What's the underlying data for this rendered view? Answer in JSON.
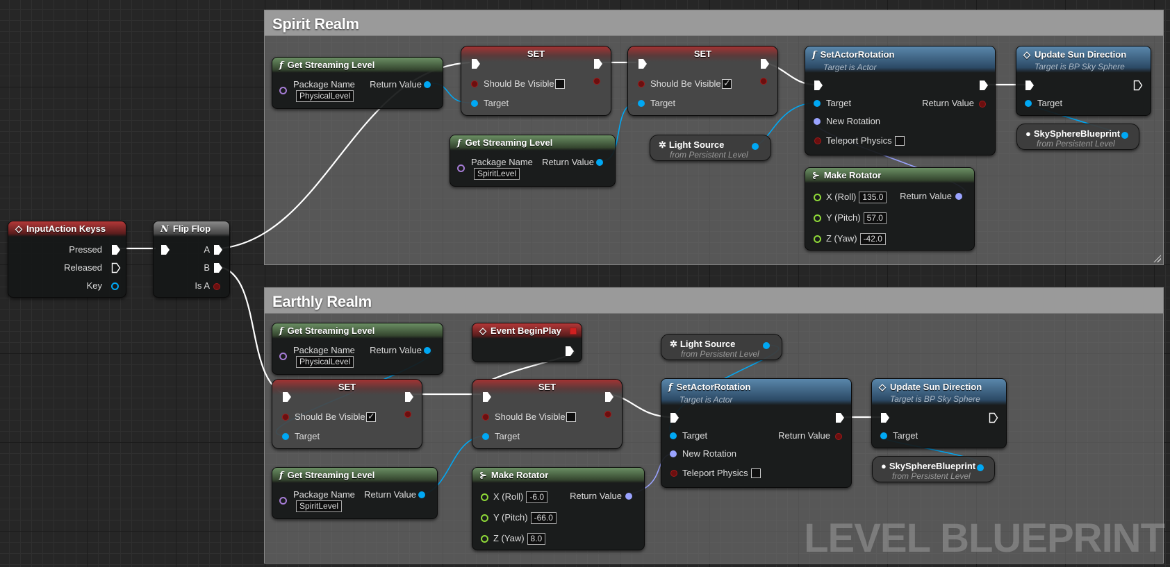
{
  "comments": {
    "spirit": "Spirit Realm",
    "earthly": "Earthly Realm"
  },
  "watermark": "LEVEL BLUEPRINT",
  "input_node": {
    "title": "InputAction Keyss",
    "pressed": "Pressed",
    "released": "Released",
    "key": "Key"
  },
  "flipflop": {
    "title": "Flip Flop",
    "a": "A",
    "b": "B",
    "is_a": "Is A"
  },
  "get_streaming": {
    "title": "Get Streaming Level",
    "package_name": "Package Name",
    "return_value": "Return Value",
    "physical": "PhysicalLevel",
    "spirit": "SpiritLevel"
  },
  "set_node": {
    "title": "SET",
    "should_be_visible": "Should Be Visible",
    "target": "Target"
  },
  "set_actor_rotation": {
    "title": "SetActorRotation",
    "subtitle": "Target is Actor",
    "target": "Target",
    "return_value": "Return Value",
    "new_rotation": "New Rotation",
    "teleport_physics": "Teleport Physics"
  },
  "update_sun": {
    "title": "Update Sun Direction",
    "subtitle": "Target is BP Sky Sphere",
    "target": "Target"
  },
  "light_source": {
    "title": "Light Source",
    "subtitle": "from Persistent Level"
  },
  "sky_sphere": {
    "title": "SkySphereBlueprint",
    "subtitle": "from Persistent Level"
  },
  "make_rotator": {
    "title": "Make Rotator",
    "x": "X (Roll)",
    "y": "Y (Pitch)",
    "z": "Z (Yaw)",
    "return_value": "Return Value",
    "spirit_values": {
      "x": "135.0",
      "y": "57.0",
      "z": "-42.0"
    },
    "earthly_values": {
      "x": "-6.0",
      "y": "-66.0",
      "z": "8.0"
    }
  },
  "event_begin_play": {
    "title": "Event BeginPlay"
  },
  "icons": {
    "function": "function-icon",
    "event": "event-diamond-icon",
    "flipflop": "flipflop-icon",
    "light": "light-bulb-icon",
    "rotator": "rotator-icon"
  },
  "colors": {
    "exec": "#ffffff",
    "object_pin": "#00a8f4",
    "bool_pin": "#a01a1a",
    "float_pin": "#8ed838",
    "struct_pin": "#9aa3ff",
    "name_pin": "#a67cd6"
  }
}
